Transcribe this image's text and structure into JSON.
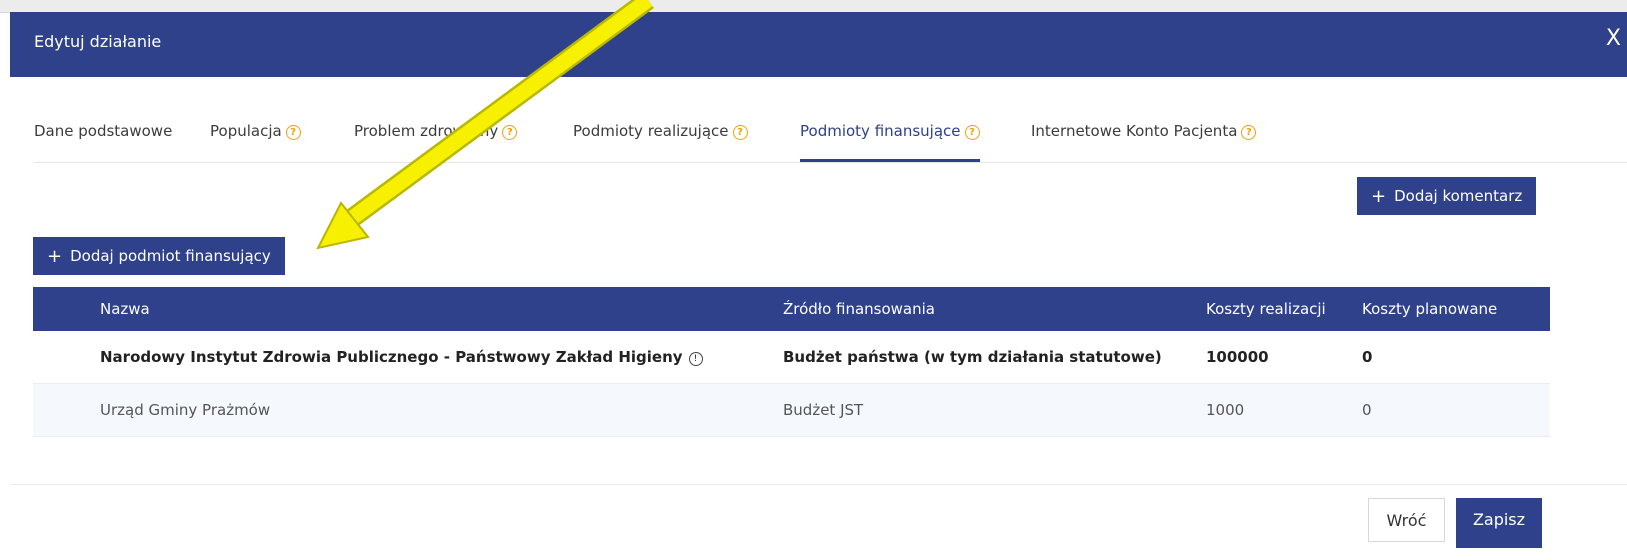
{
  "modal": {
    "title": "Edytuj działanie",
    "close_label": "X"
  },
  "tabs": [
    {
      "label": "Dane podstawowe",
      "help": false
    },
    {
      "label": "Populacja",
      "help": true
    },
    {
      "label": "Problem zdrowotny",
      "help": true
    },
    {
      "label": "Podmioty realizujące",
      "help": true
    },
    {
      "label": "Podmioty finansujące",
      "help": true,
      "active": true
    },
    {
      "label": "Internetowe Konto Pacjenta",
      "help": true
    }
  ],
  "help_glyph": "?",
  "buttons": {
    "add_comment": "Dodaj komentarz",
    "add_funder": "Dodaj podmiot finansujący",
    "plus_glyph": "+",
    "back": "Wróć",
    "save": "Zapisz"
  },
  "table": {
    "columns": [
      "Nazwa",
      "Źródło finansowania",
      "Koszty realizacji",
      "Koszty planowane"
    ],
    "rows": [
      {
        "name": "Narodowy Instytut Zdrowia Publicznego - Państwowy Zakład Higieny",
        "source": "Budżet państwa (w tym działania statutowe)",
        "cost_real": "100000",
        "cost_plan": "0"
      },
      {
        "name": "Urząd Gminy Prażmów",
        "source": "Budżet JST",
        "cost_real": "1000",
        "cost_plan": "0"
      }
    ],
    "info_glyph": "!"
  },
  "annotation": {
    "color": "#f7f000",
    "outline": "#b8b800"
  }
}
